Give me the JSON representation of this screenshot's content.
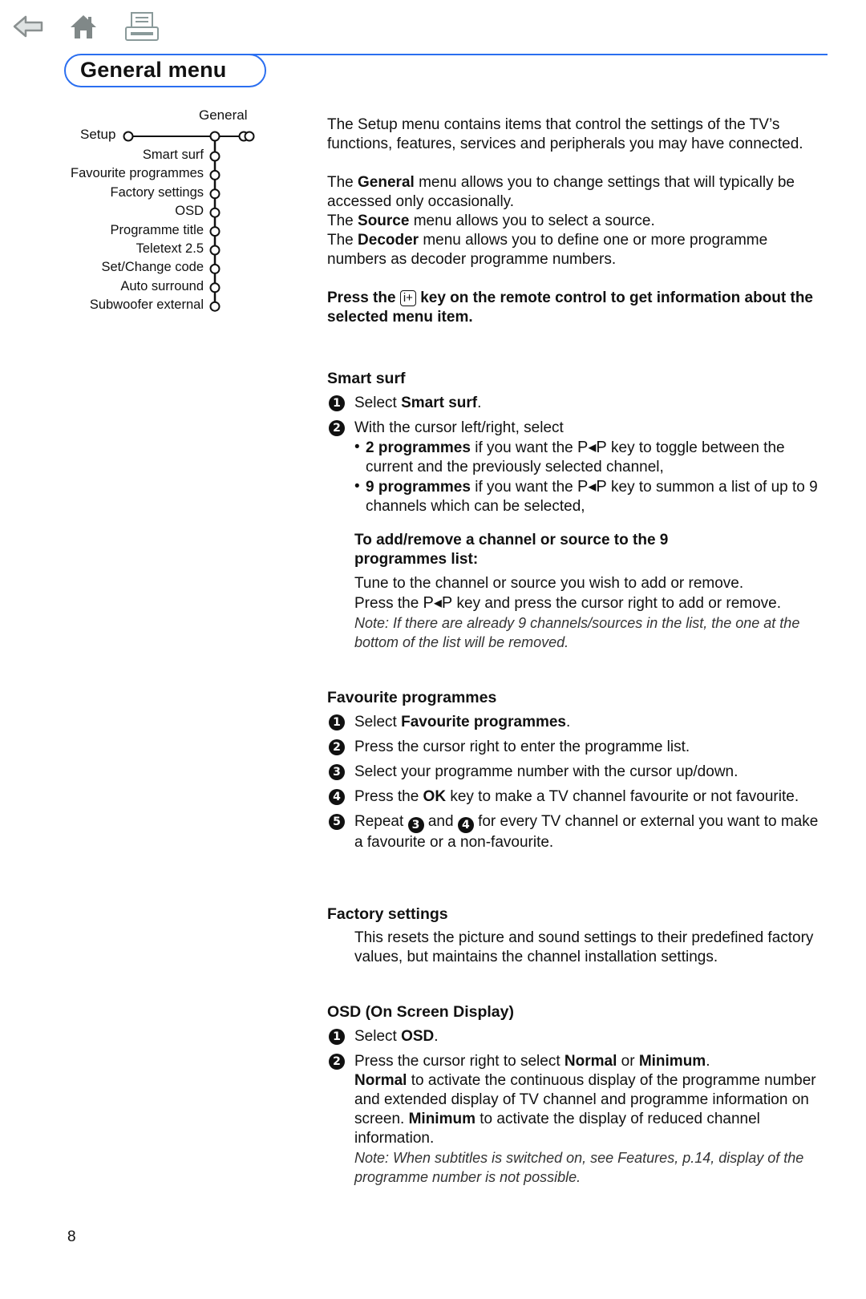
{
  "nav": {
    "icons": [
      "back-arrow-icon",
      "home-icon",
      "print-icon"
    ],
    "colors": {
      "icon_gray": "#8a9090",
      "accent_blue": "#2b6ff0"
    }
  },
  "header": {
    "title": "General menu"
  },
  "menu_tree": {
    "root": "Setup",
    "branch": "General",
    "items": [
      "Smart surf",
      "Favourite programmes",
      "Factory settings",
      "OSD",
      "Programme title",
      "Teletext 2.5",
      "Set/Change code",
      "Auto surround",
      "Subwoofer external"
    ]
  },
  "intro": {
    "p1": "The Setup menu contains items that control the settings of the TV’s functions, features, services and peripherals you may have connected.",
    "p2_pre": "The ",
    "p2_bold": "General",
    "p2_post": " menu allows you to change settings that will typically be accessed only occasionally.",
    "p3_pre": "The ",
    "p3_bold": "Source",
    "p3_post": " menu allows you to select a source.",
    "p4_pre": "The ",
    "p4_bold": "Decoder",
    "p4_post": " menu allows you to define one or more programme numbers as decoder programme numbers.",
    "info_pre": "Press the ",
    "info_key": "i+",
    "info_post": " key on the remote control to get information about the selected menu item."
  },
  "smart_surf": {
    "heading": "Smart surf",
    "step1_num": "1",
    "step1_pre": "Select ",
    "step1_bold": "Smart surf",
    "step1_post": ".",
    "step2_num": "2",
    "step2_text": "With the cursor left/right, select",
    "bullet1_bold": "2 programmes",
    "bullet1_pre": " if you want the ",
    "pp_key": "P◂P",
    "bullet1_post": " key to toggle between the current and the previously selected channel,",
    "bullet2_bold": "9 programmes",
    "bullet2_pre": " if you want the ",
    "bullet2_post": " key to summon a list of up to 9 channels which can be selected,",
    "sub_heading": "To add/remove a channel or source to the 9 programmes list:",
    "sub_p1": "Tune to the channel or source you wish to add or remove.",
    "sub_p2_pre": "Press the ",
    "sub_p2_post": " key and press the cursor right to add or remove.",
    "note": "Note: If there are already 9 channels/sources in the list, the one at the bottom of the list will be removed."
  },
  "favourite": {
    "heading": "Favourite programmes",
    "s1_num": "1",
    "s1_pre": "Select ",
    "s1_bold": "Favourite programmes",
    "s1_post": ".",
    "s2_num": "2",
    "s2_text": "Press the cursor right to enter the programme list.",
    "s3_num": "3",
    "s3_text": "Select your programme number with the cursor up/down.",
    "s4_num": "4",
    "s4_pre": "Press the ",
    "s4_bold": "OK",
    "s4_post": " key to make a TV channel favourite or not favourite.",
    "s5_num": "5",
    "s5_pre": "Repeat ",
    "s5_ref1": "3",
    "s5_mid": " and ",
    "s5_ref2": "4",
    "s5_post": " for every TV channel or external you want to make a favourite or a non-favourite."
  },
  "factory": {
    "heading": "Factory settings",
    "text": "This resets the picture and sound settings to their predefined factory values, but maintains the channel installation settings."
  },
  "osd": {
    "heading": "OSD (On Screen Display)",
    "s1_num": "1",
    "s1_pre": "Select ",
    "s1_bold": "OSD",
    "s1_post": ".",
    "s2_num": "2",
    "s2_pre": "Press the cursor right to select ",
    "s2_b1": "Normal",
    "s2_mid": " or ",
    "s2_b2": "Minimum",
    "s2_end": ".",
    "s2_b3": "Normal",
    "s2_p2": " to activate the continuous display of the programme number and extended display of TV channel and programme information on screen. ",
    "s2_b4": "Minimum",
    "s2_p3": " to activate the display of reduced channel information.",
    "note": "Note: When subtitles is switched on, see Features, p.14, display of the programme number is not possible."
  },
  "footer": {
    "page_number": "8"
  }
}
